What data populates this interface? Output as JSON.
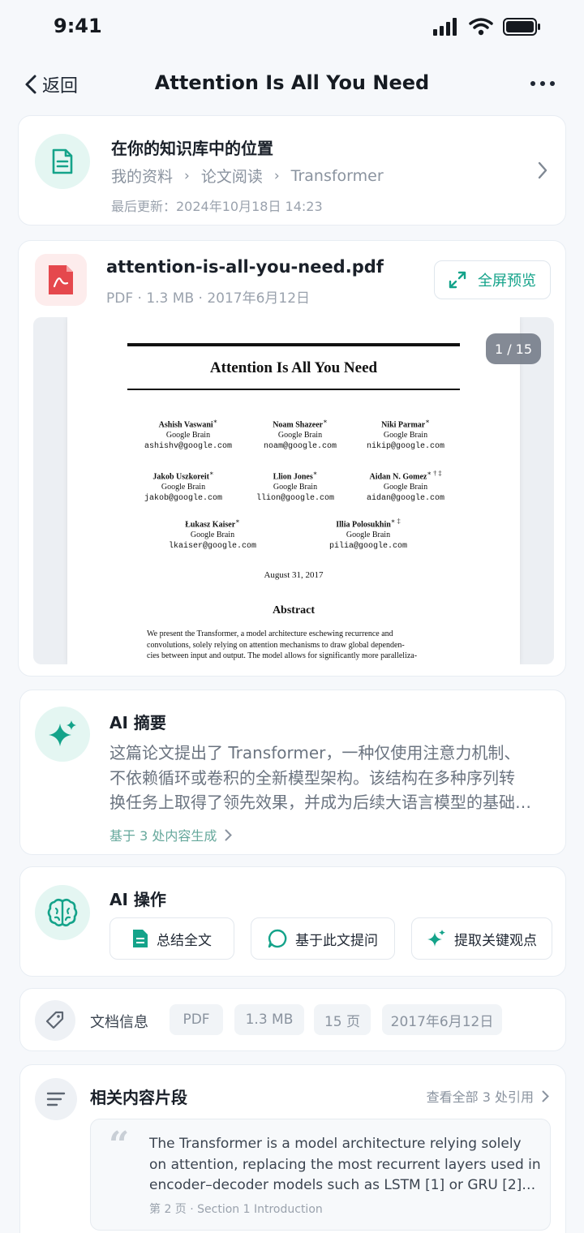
{
  "status_bar": {
    "time": "9:41"
  },
  "nav": {
    "back_label": "返回",
    "title": "Attention Is All You Need"
  },
  "location": {
    "title": "在你的知识库中的位置",
    "breadcrumb": [
      "我的资料",
      "论文阅读",
      "Transformer"
    ],
    "updated": "最后更新：2024年10月18日 14:23"
  },
  "file": {
    "name": "attention-is-all-you-need.pdf",
    "meta": "PDF · 1.3 MB · 2017年6月12日",
    "fullscreen_label": "全屏预览",
    "page_indicator": "1 / 15"
  },
  "pdf_page": {
    "title": "Attention Is All You Need",
    "authors": [
      {
        "name": "Ashish Vaswani",
        "mark": "∗",
        "org": "Google Brain",
        "email": "ashishv@google.com"
      },
      {
        "name": "Noam Shazeer",
        "mark": "∗",
        "org": "Google Brain",
        "email": "noam@google.com"
      },
      {
        "name": "Niki Parmar",
        "mark": "∗",
        "org": "Google Brain",
        "email": "nikip@google.com"
      },
      {
        "name": "Jakob Uszkoreit",
        "mark": "∗",
        "org": "Google Brain",
        "email": "jakob@google.com"
      },
      {
        "name": "Llion Jones",
        "mark": "∗",
        "org": "Google Brain",
        "email": "llion@google.com"
      },
      {
        "name": "Aidan N. Gomez",
        "mark": "∗ † ‡",
        "org": "Google Brain",
        "email": "aidan@google.com"
      },
      {
        "name": "Łukasz Kaiser",
        "mark": "∗",
        "org": "Google Brain",
        "email": "lkaiser@google.com"
      },
      {
        "name": "Illia Polosukhin",
        "mark": "∗ ‡",
        "org": "Google Brain",
        "email": "pilia@google.com"
      }
    ],
    "date": "August 31, 2017",
    "abstract_title": "Abstract",
    "abstract_lines": [
      "We present the Transformer, a model architecture eschewing recurrence and",
      "convolutions, solely relying on attention mechanisms to draw global dependen-",
      "cies between input and output. The model allows for significantly more paralleliza-"
    ]
  },
  "ai_summary": {
    "title": "AI 摘要",
    "lines": [
      "这篇论文提出了 Transformer，一种仅使用注意力机制、",
      "不依赖循环或卷积的全新模型架构。该结构在多种序列转",
      "换任务上取得了领先效果，并成为后续大语言模型的基础…"
    ],
    "source_link": "基于 3 处内容生成"
  },
  "ai_actions": {
    "title": "AI 操作",
    "buttons": [
      "总结全文",
      "基于此文提问",
      "提取关键观点"
    ]
  },
  "doc_info": {
    "label": "文档信息",
    "chips": [
      "PDF",
      "1.3 MB",
      "15 页",
      "2017年6月12日"
    ]
  },
  "related": {
    "title": "相关内容片段",
    "view_all": "查看全部 3 处引用",
    "quote_lines": [
      "The Transformer is a model architecture relying solely",
      "on attention, replacing the most recurrent layers used in",
      "encoder–decoder models such as LSTM [1] or GRU [2]…"
    ],
    "quote_source": "第 2 页 · Section 1 Introduction"
  },
  "colors": {
    "accent": "#14a38a",
    "accent_bg": "#e4f6f2",
    "pdf_red": "#e5484d",
    "background": "#f6f8fb"
  }
}
